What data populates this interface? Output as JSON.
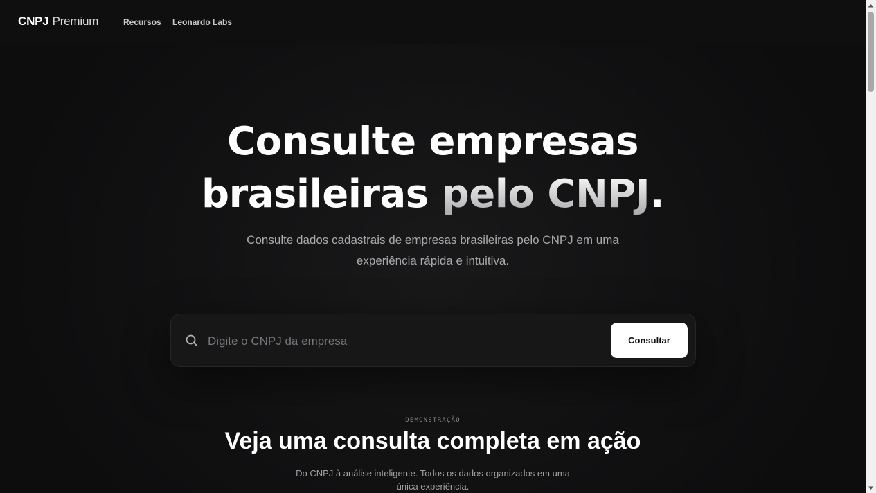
{
  "header": {
    "brand_bold": "CNPJ",
    "brand_light": "Premium",
    "nav": [
      {
        "label": "Recursos"
      },
      {
        "label": "Leonardo Labs"
      }
    ]
  },
  "hero": {
    "title_line1": "Consulte empresas",
    "title_line2_plain": "brasileiras",
    "title_line2_gradient": "pelo CNPJ",
    "title_line2_end": ".",
    "subtitle_line1": "Consulte dados cadastrais de empresas brasileiras pelo CNPJ em uma",
    "subtitle_line2": "experiência rápida e intuitiva."
  },
  "search": {
    "icon": "search-icon",
    "value": "",
    "placeholder": "Digite o CNPJ da empresa",
    "button_label": "Consultar"
  },
  "demo": {
    "eyebrow": "DEMONSTRAÇÃO",
    "title": "Veja uma consulta completa em ação",
    "subtitle_line1": "Do CNPJ à análise inteligente. Todos os dados organizados em uma",
    "subtitle_line2": "única experiência."
  },
  "colors": {
    "background": "#0e0e0f",
    "button_bg": "#ffffff",
    "text_muted": "#a9a9ae"
  }
}
